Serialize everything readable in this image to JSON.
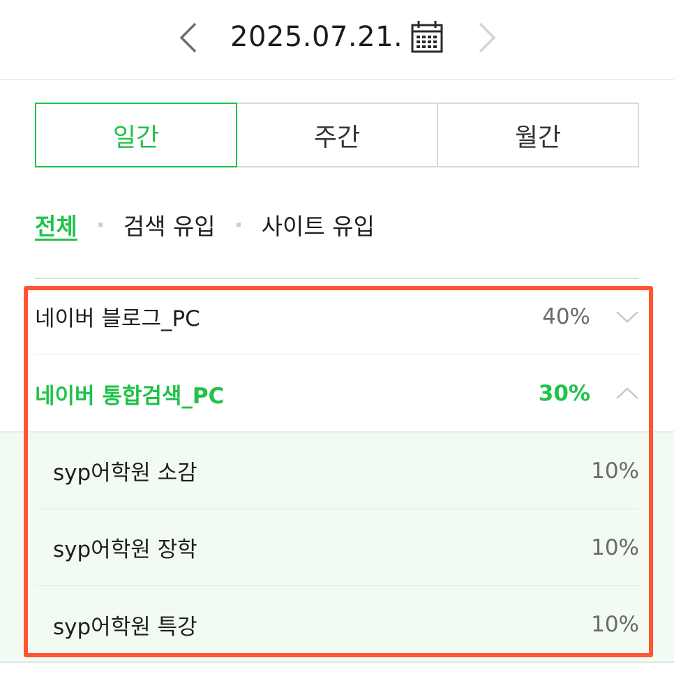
{
  "date_nav": {
    "date": "2025.07.21.",
    "prev_icon": "chevron-left-icon",
    "next_icon": "chevron-right-icon",
    "calendar_icon": "calendar-icon"
  },
  "period_tabs": [
    {
      "label": "일간",
      "active": true
    },
    {
      "label": "주간",
      "active": false
    },
    {
      "label": "월간",
      "active": false
    }
  ],
  "filters": [
    {
      "label": "전체",
      "active": true
    },
    {
      "label": "검색 유입",
      "active": false
    },
    {
      "label": "사이트 유입",
      "active": false
    }
  ],
  "rows": [
    {
      "label": "네이버 블로그_PC",
      "value": "40%",
      "expanded": false
    },
    {
      "label": "네이버 통합검색_PC",
      "value": "30%",
      "expanded": true
    }
  ],
  "sub_rows": [
    {
      "label": "syp어학원 소감",
      "value": "10%"
    },
    {
      "label": "syp어학원 장학",
      "value": "10%"
    },
    {
      "label": "syp어학원 특강",
      "value": "10%"
    }
  ],
  "colors": {
    "accent": "#20c24a",
    "highlight": "#ff5534",
    "sub_background": "#f2fbf2"
  }
}
